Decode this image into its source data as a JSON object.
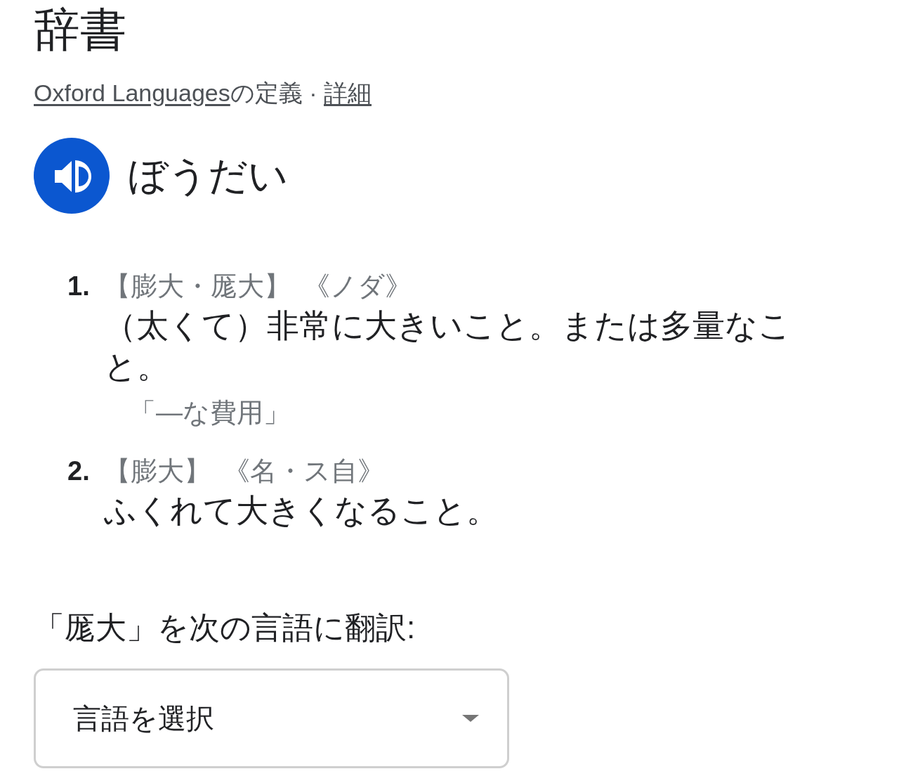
{
  "heading": "辞書",
  "source": {
    "link": "Oxford Languages",
    "text": "の定義",
    "separator": "·",
    "more_link": "詳細"
  },
  "entry": {
    "reading": "ぼうだい",
    "senses": [
      {
        "number": "1.",
        "headword": "【膨大・厖大】",
        "grammar": "《ノダ》",
        "definition": "（太くて）非常に大きいこと。または多量なこと。",
        "examples": [
          "「—な費用」"
        ]
      },
      {
        "number": "2.",
        "headword": "【膨大】",
        "grammar": "《名・ス自》",
        "definition": "ふくれて大きくなること。"
      }
    ]
  },
  "translate": {
    "label": "「厖大」を次の言語に翻訳:",
    "dropdown": {
      "text": "言語を選択"
    }
  }
}
